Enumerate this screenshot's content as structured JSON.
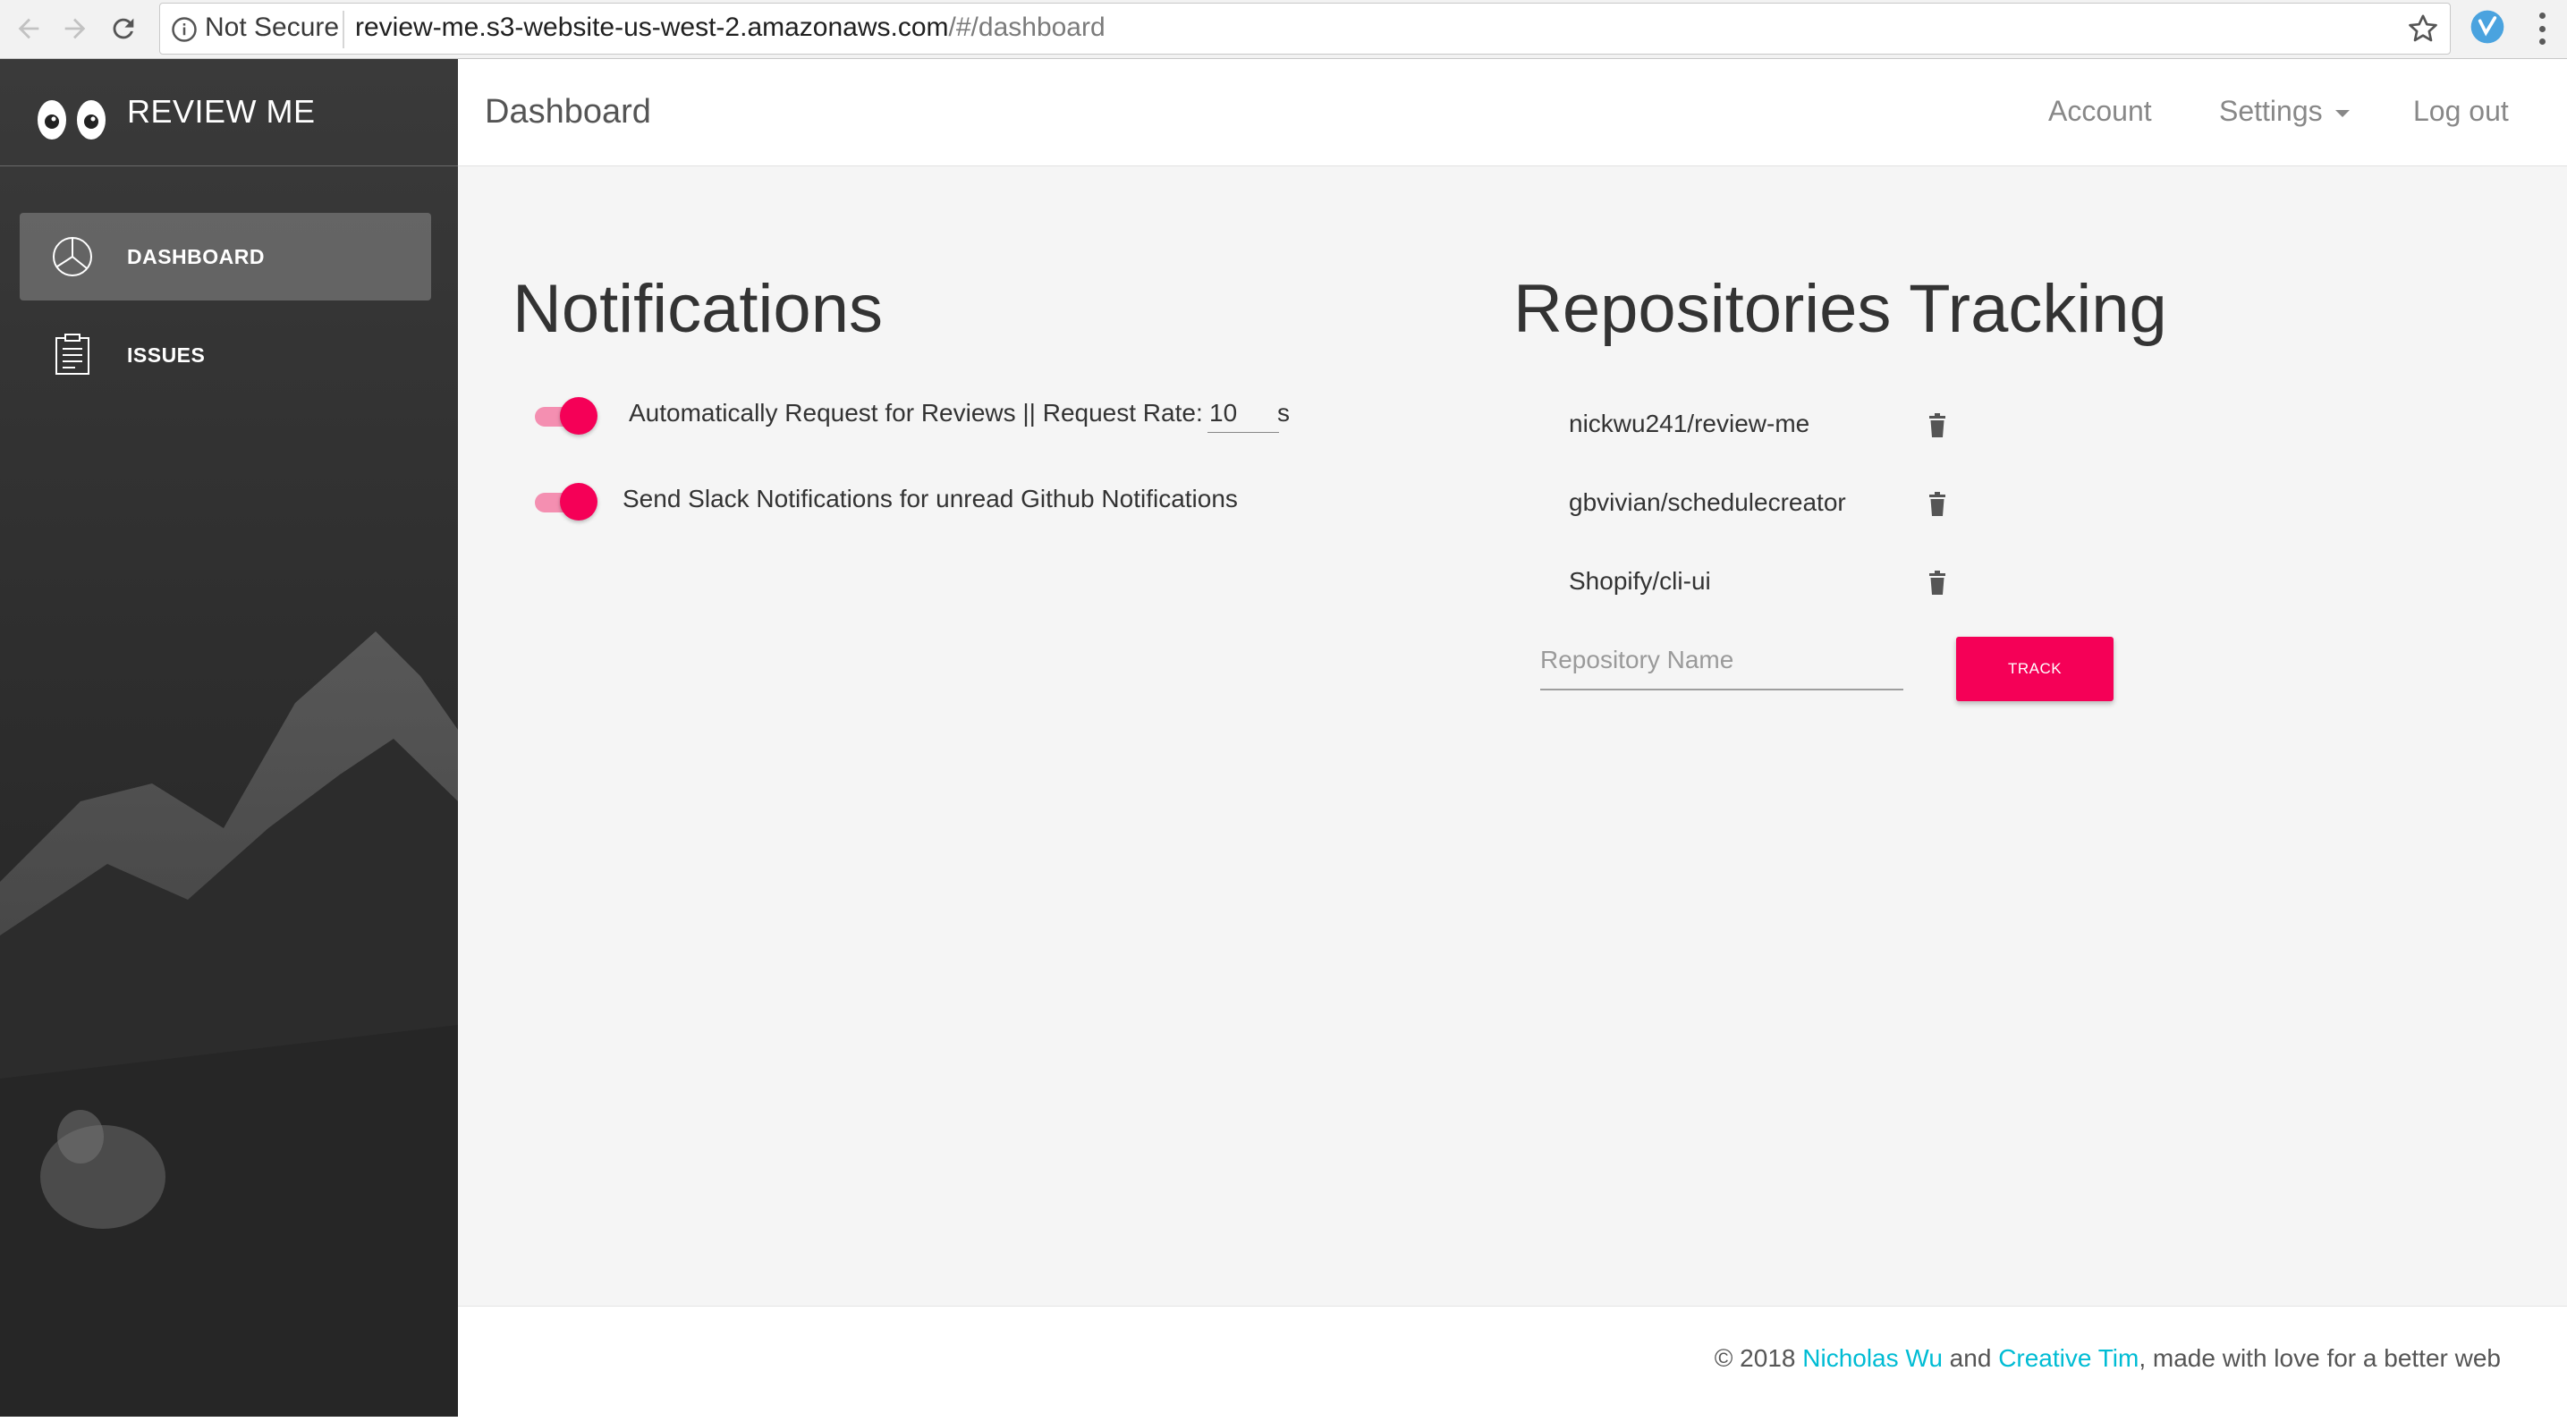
{
  "browser": {
    "security_label": "Not Secure",
    "url_host": "review-me.s3-website-us-west-2.amazonaws.com",
    "url_path": "/#/dashboard"
  },
  "sidebar": {
    "brand": "REVIEW ME",
    "items": [
      {
        "label": "DASHBOARD",
        "icon": "pie-chart-icon",
        "active": true
      },
      {
        "label": "ISSUES",
        "icon": "clipboard-icon",
        "active": false
      }
    ]
  },
  "header": {
    "title": "Dashboard",
    "nav": {
      "account": "Account",
      "settings": "Settings",
      "logout": "Log out"
    }
  },
  "notifications": {
    "heading": "Notifications",
    "auto_request": {
      "label": "Automatically Request for Reviews || Request Rate:",
      "rate": "10",
      "unit": "s",
      "enabled": true
    },
    "slack": {
      "label": "Send Slack Notifications for unread Github Notifications",
      "enabled": true
    }
  },
  "repositories": {
    "heading": "Repositories Tracking",
    "items": [
      "nickwu241/review-me",
      "gbvivian/schedulecreator",
      "Shopify/cli-ui"
    ],
    "input_placeholder": "Repository Name",
    "track_label": "TRACK"
  },
  "footer": {
    "prefix": "© 2018 ",
    "author": "Nicholas Wu",
    "and": " and ",
    "partner": "Creative Tim",
    "suffix": ", made with love for a better web"
  },
  "colors": {
    "accent": "#f50057",
    "link": "#00bcd4",
    "sidebar_bg": "#2f2f2f"
  }
}
